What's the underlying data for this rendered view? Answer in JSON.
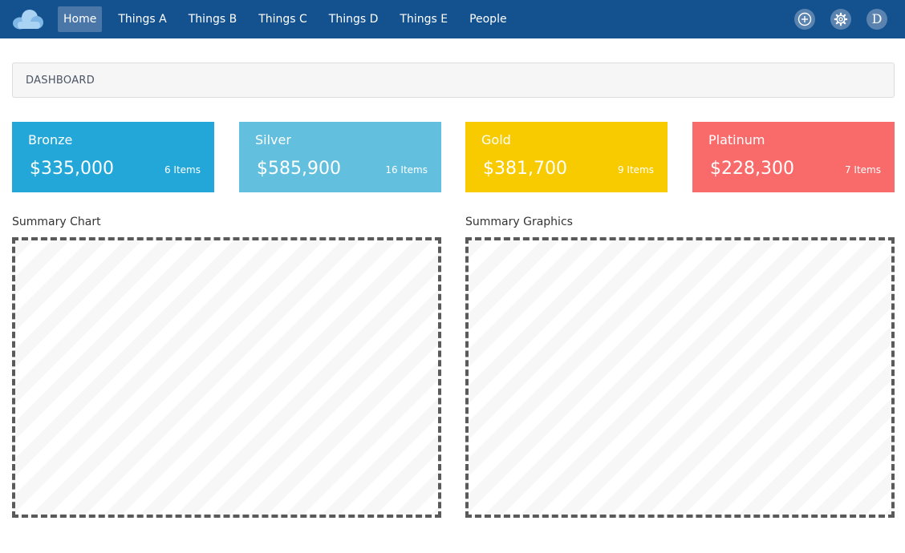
{
  "navbar": {
    "items": [
      {
        "label": "Home",
        "active": true
      },
      {
        "label": "Things A"
      },
      {
        "label": "Things B"
      },
      {
        "label": "Things C"
      },
      {
        "label": "Things D"
      },
      {
        "label": "Things E"
      },
      {
        "label": "People"
      }
    ],
    "actions": {
      "add_icon": "plus-circle-icon",
      "settings_icon": "gear-icon",
      "avatar_letter": "D"
    },
    "colors": {
      "bar": "#14528f",
      "active_item": "#4a76a8"
    }
  },
  "breadcrumb": {
    "label": "DASHBOARD"
  },
  "cards": [
    {
      "title": "Bronze",
      "value": "$335,000",
      "count": "6 Items",
      "color": "#22a7d8"
    },
    {
      "title": "Silver",
      "value": "$585,900",
      "count": "16 Items",
      "color": "#62c0de"
    },
    {
      "title": "Gold",
      "value": "$381,700",
      "count": "9 Items",
      "color": "#f7cb00"
    },
    {
      "title": "Platinum",
      "value": "$228,300",
      "count": "7 Items",
      "color": "#f96b6b"
    }
  ],
  "sections": {
    "chart_title": "Summary Chart",
    "graphics_title": "Summary Graphics"
  }
}
